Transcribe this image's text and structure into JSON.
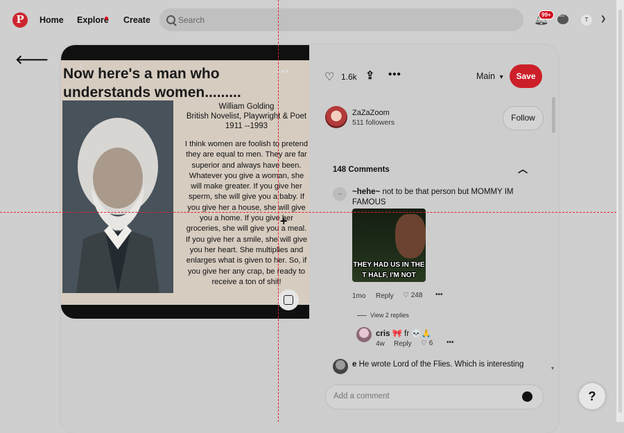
{
  "nav": {
    "logo": "P",
    "home": "Home",
    "explore": "Explore",
    "create": "Create",
    "search_placeholder": "Search",
    "notification_badge": "99+",
    "avatar_initial": "T"
  },
  "pin": {
    "image": {
      "headline_line1": "Now here's a man who",
      "headline_line2": "understands women.........",
      "author_name": "William Golding",
      "author_desc": "British Novelist, Playwright & Poet",
      "author_years": "1911 --1993",
      "quote": "I think women are foolish to pretend they are equal to men. They are far superior and always have been. Whatever you give a woman, she will make greater. If you give her sperm, she will give you a baby. If you give her a house, she will give you a home. If you give her groceries, she will give you a meal. If you give her a smile, she will give you her heart. She multiplies and enlarges what is given to her. So, if you give her any crap, be ready to receive a ton of shit!"
    },
    "like_count": "1.6k",
    "board": "Main",
    "save_label": "Save",
    "creator": {
      "name": "ZaZaZoom",
      "followers": "511 followers"
    },
    "follow_label": "Follow",
    "comments_header": "148 Comments",
    "comments": [
      {
        "avatar": "~",
        "author": "~hehe~",
        "text": "not to be that person but MOMMY IM FAMOUS",
        "gif_caption_line1": "THEY HAD US IN THE",
        "gif_caption_line2": "T HALF, I'M NOT GONN",
        "time": "1mo",
        "reply_label": "Reply",
        "likes": "248",
        "view_replies": "View 2 replies",
        "reply": {
          "author": "cris",
          "text": "🎀 fr 💀🙏",
          "time": "4w",
          "reply_label": "Reply",
          "likes": "6"
        }
      },
      {
        "author": "e",
        "text": "He wrote Lord of the Flies. Which is interesting"
      }
    ],
    "comment_placeholder": "Add a comment"
  },
  "help_label": "?"
}
